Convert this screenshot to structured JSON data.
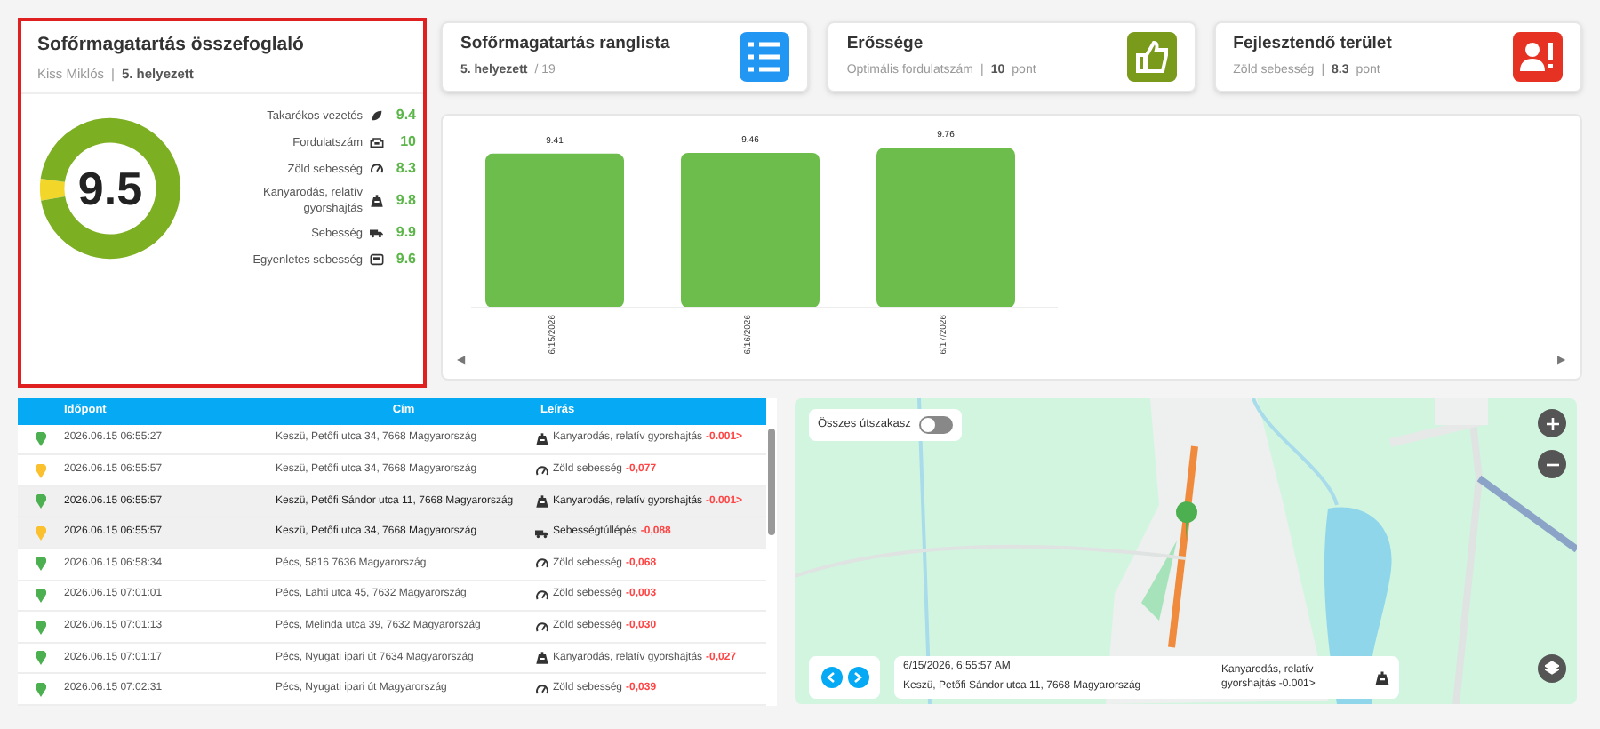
{
  "summary": {
    "title": "Sofőrmagatartás összefoglaló",
    "driver": "Kiss Miklós",
    "separator": "|",
    "rank": "5. helyezett",
    "score": "9.5",
    "metrics": [
      {
        "label": "Takarékos vezetés",
        "kind": "leaf",
        "value": "9.4"
      },
      {
        "label": "Fordulatszám",
        "kind": "engine",
        "value": "10"
      },
      {
        "label": "Zöld sebesség",
        "kind": "gauge",
        "value": "8.3"
      },
      {
        "label": "Kanyarodás, relatív gyorshajtás",
        "kind": "turn",
        "value": "9.8"
      },
      {
        "label": "Sebesség",
        "kind": "truck",
        "value": "9.9"
      },
      {
        "label": "Egyenletes sebesség",
        "kind": "bus",
        "value": "9.6"
      }
    ]
  },
  "cards": [
    {
      "kind": "ranking",
      "title": "Sofőrmagatartás ranglista",
      "bold": "5. helyezett",
      "rest": "/ 19"
    },
    {
      "kind": "strength",
      "title": "Erőssége",
      "plain": "Optimális fordulatszám",
      "separator": "|",
      "bold": "10",
      "rest": "pont"
    },
    {
      "kind": "improve",
      "title": "Fejlesztendő terület",
      "plain": "Zöld sebesség",
      "separator": "|",
      "bold": "8.3",
      "rest": "pont"
    }
  ],
  "chart": {
    "chart_data": {
      "type": "bar",
      "categories": [
        "6/15/2026",
        "6/16/2026",
        "6/17/2026"
      ],
      "series": [
        {
          "color": "#6cbd4b",
          "values": [
            9.41,
            9.46,
            9.76
          ]
        }
      ],
      "data_labels": true,
      "value_labels": [
        "9.41",
        "9.46",
        "9.76"
      ]
    },
    "scroll_left": "◀",
    "scroll_right": "▶"
  },
  "table": {
    "columns": [
      "Időpont",
      "Cím",
      "Leírás"
    ],
    "rows": [
      {
        "color": "#4caf50",
        "selected": false,
        "time": "2026.06.15 06:55:27",
        "address": "Keszü, Petőfi utca 34, 7668 Magyarország",
        "kind": "turn",
        "event": "Kanyarodás, relatív gyorshajtás",
        "delta": "-0.001>"
      },
      {
        "color": "#fbc02d",
        "selected": false,
        "time": "2026.06.15 06:55:57",
        "address": "Keszü, Petőfi utca 34, 7668 Magyarország",
        "kind": "gauge",
        "event": "Zöld sebesség",
        "delta": "-0,077"
      },
      {
        "color": "#4caf50",
        "selected": true,
        "time": "2026.06.15 06:55:57",
        "address": "Keszü, Petőfi Sándor utca 11, 7668 Magyarország",
        "kind": "turn",
        "event": "Kanyarodás, relatív gyorshajtás",
        "delta": "-0.001>"
      },
      {
        "color": "#fbc02d",
        "selected": true,
        "time": "2026.06.15 06:55:57",
        "address": "Keszü, Petőfi utca 34, 7668 Magyarország",
        "kind": "truck",
        "event": "Sebességtúllépés",
        "delta": "-0,088"
      },
      {
        "color": "#4caf50",
        "selected": false,
        "time": "2026.06.15 06:58:34",
        "address": "Pécs, 5816 7636 Magyarország",
        "kind": "gauge",
        "event": "Zöld sebesség",
        "delta": "-0,068"
      },
      {
        "color": "#4caf50",
        "selected": false,
        "time": "2026.06.15 07:01:01",
        "address": "Pécs, Lahti utca 45, 7632 Magyarország",
        "kind": "gauge",
        "event": "Zöld sebesség",
        "delta": "-0,003"
      },
      {
        "color": "#4caf50",
        "selected": false,
        "time": "2026.06.15 07:01:13",
        "address": "Pécs, Melinda utca 39, 7632 Magyarország",
        "kind": "gauge",
        "event": "Zöld sebesség",
        "delta": "-0,030"
      },
      {
        "color": "#4caf50",
        "selected": false,
        "time": "2026.06.15 07:01:17",
        "address": "Pécs, Nyugati ipari út 7634 Magyarország",
        "kind": "turn",
        "event": "Kanyarodás, relatív gyorshajtás",
        "delta": "-0,027"
      },
      {
        "color": "#4caf50",
        "selected": false,
        "time": "2026.06.15 07:02:31",
        "address": "Pécs, Nyugati ipari út Magyarország",
        "kind": "gauge",
        "event": "Zöld sebesség",
        "delta": "-0,039"
      }
    ]
  },
  "map": {
    "toggle": {
      "label": "Összes útszakasz",
      "on": false
    },
    "info": {
      "time": "6/15/2026, 6:55:57 AM",
      "address": "Keszü, Petőfi Sándor utca 11, 7668 Magyarország",
      "event": "Kanyarodás, relatív gyorshajtás -0.001>",
      "kind": "turn"
    }
  }
}
